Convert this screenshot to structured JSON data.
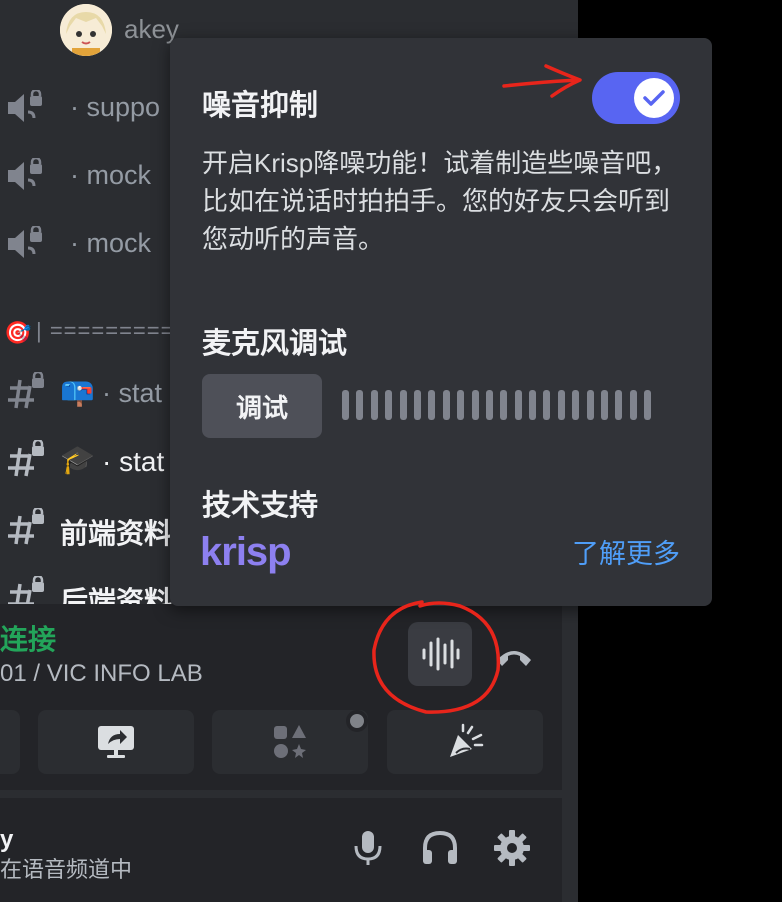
{
  "sidebar": {
    "user": {
      "name": "akey"
    },
    "voice_channels": [
      {
        "name": "· suppo"
      },
      {
        "name": "· mock"
      },
      {
        "name": "· mock"
      }
    ],
    "separator": "| ==========",
    "text_channels": [
      {
        "emoji": "📪",
        "name": "· stat"
      },
      {
        "emoji": "🎓",
        "name": "· stat"
      },
      {
        "emoji": "",
        "name": "前端资料"
      },
      {
        "emoji": "",
        "name": "后端资料"
      }
    ]
  },
  "voice_panel": {
    "status": "连接",
    "channel": "01 / VIC INFO LAB"
  },
  "user_panel": {
    "name": "y",
    "status": "在语音频道中"
  },
  "popup": {
    "noise_title": "噪音抑制",
    "noise_enabled": true,
    "description": "开启Krisp降噪功能！试着制造些噪音吧，比如在说话时拍拍手。您的好友只会听到您动听的声音。",
    "mic_title": "麦克风调试",
    "test_button": "调试",
    "support_title": "技术支持",
    "krisp_logo": "krisp",
    "learn_more": "了解更多"
  },
  "colors": {
    "accent": "#5865f2",
    "link": "#4f9ef8",
    "connected": "#23a55a",
    "annotation": "#e8251b"
  },
  "icons": [
    "speaker-lock-icon",
    "hash-lock-icon",
    "noise-suppression-icon",
    "hangup-icon",
    "screen-share-icon",
    "activities-icon",
    "soundboard-icon",
    "microphone-icon",
    "headphones-icon",
    "gear-icon",
    "check-icon"
  ]
}
